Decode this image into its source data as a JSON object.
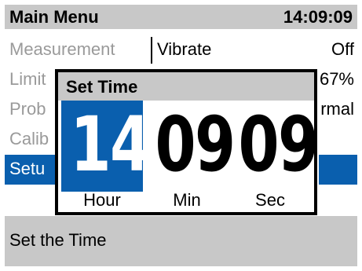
{
  "header": {
    "title": "Main Menu",
    "time": "14:09:09"
  },
  "menu": {
    "items": [
      {
        "label": "Measurement",
        "value_name": "Vibrate",
        "value": "Off"
      },
      {
        "label": "Limit",
        "value_name": "",
        "value": "67%"
      },
      {
        "label": "Prob",
        "value_name": "",
        "value": "rmal"
      },
      {
        "label": "Calib",
        "value_name": "",
        "value": ""
      },
      {
        "label": "Setu",
        "value_name": "",
        "value": ""
      }
    ]
  },
  "dialog": {
    "title": "Set Time",
    "hour": "14",
    "minute": "09",
    "second": "09",
    "hour_label": "Hour",
    "minute_label": "Min",
    "second_label": "Sec"
  },
  "footer": {
    "text": "Set the Time"
  },
  "colors": {
    "highlight": "#0a5fae",
    "header_bg": "#c8c8c8",
    "disabled_text": "#9a9a9a"
  }
}
